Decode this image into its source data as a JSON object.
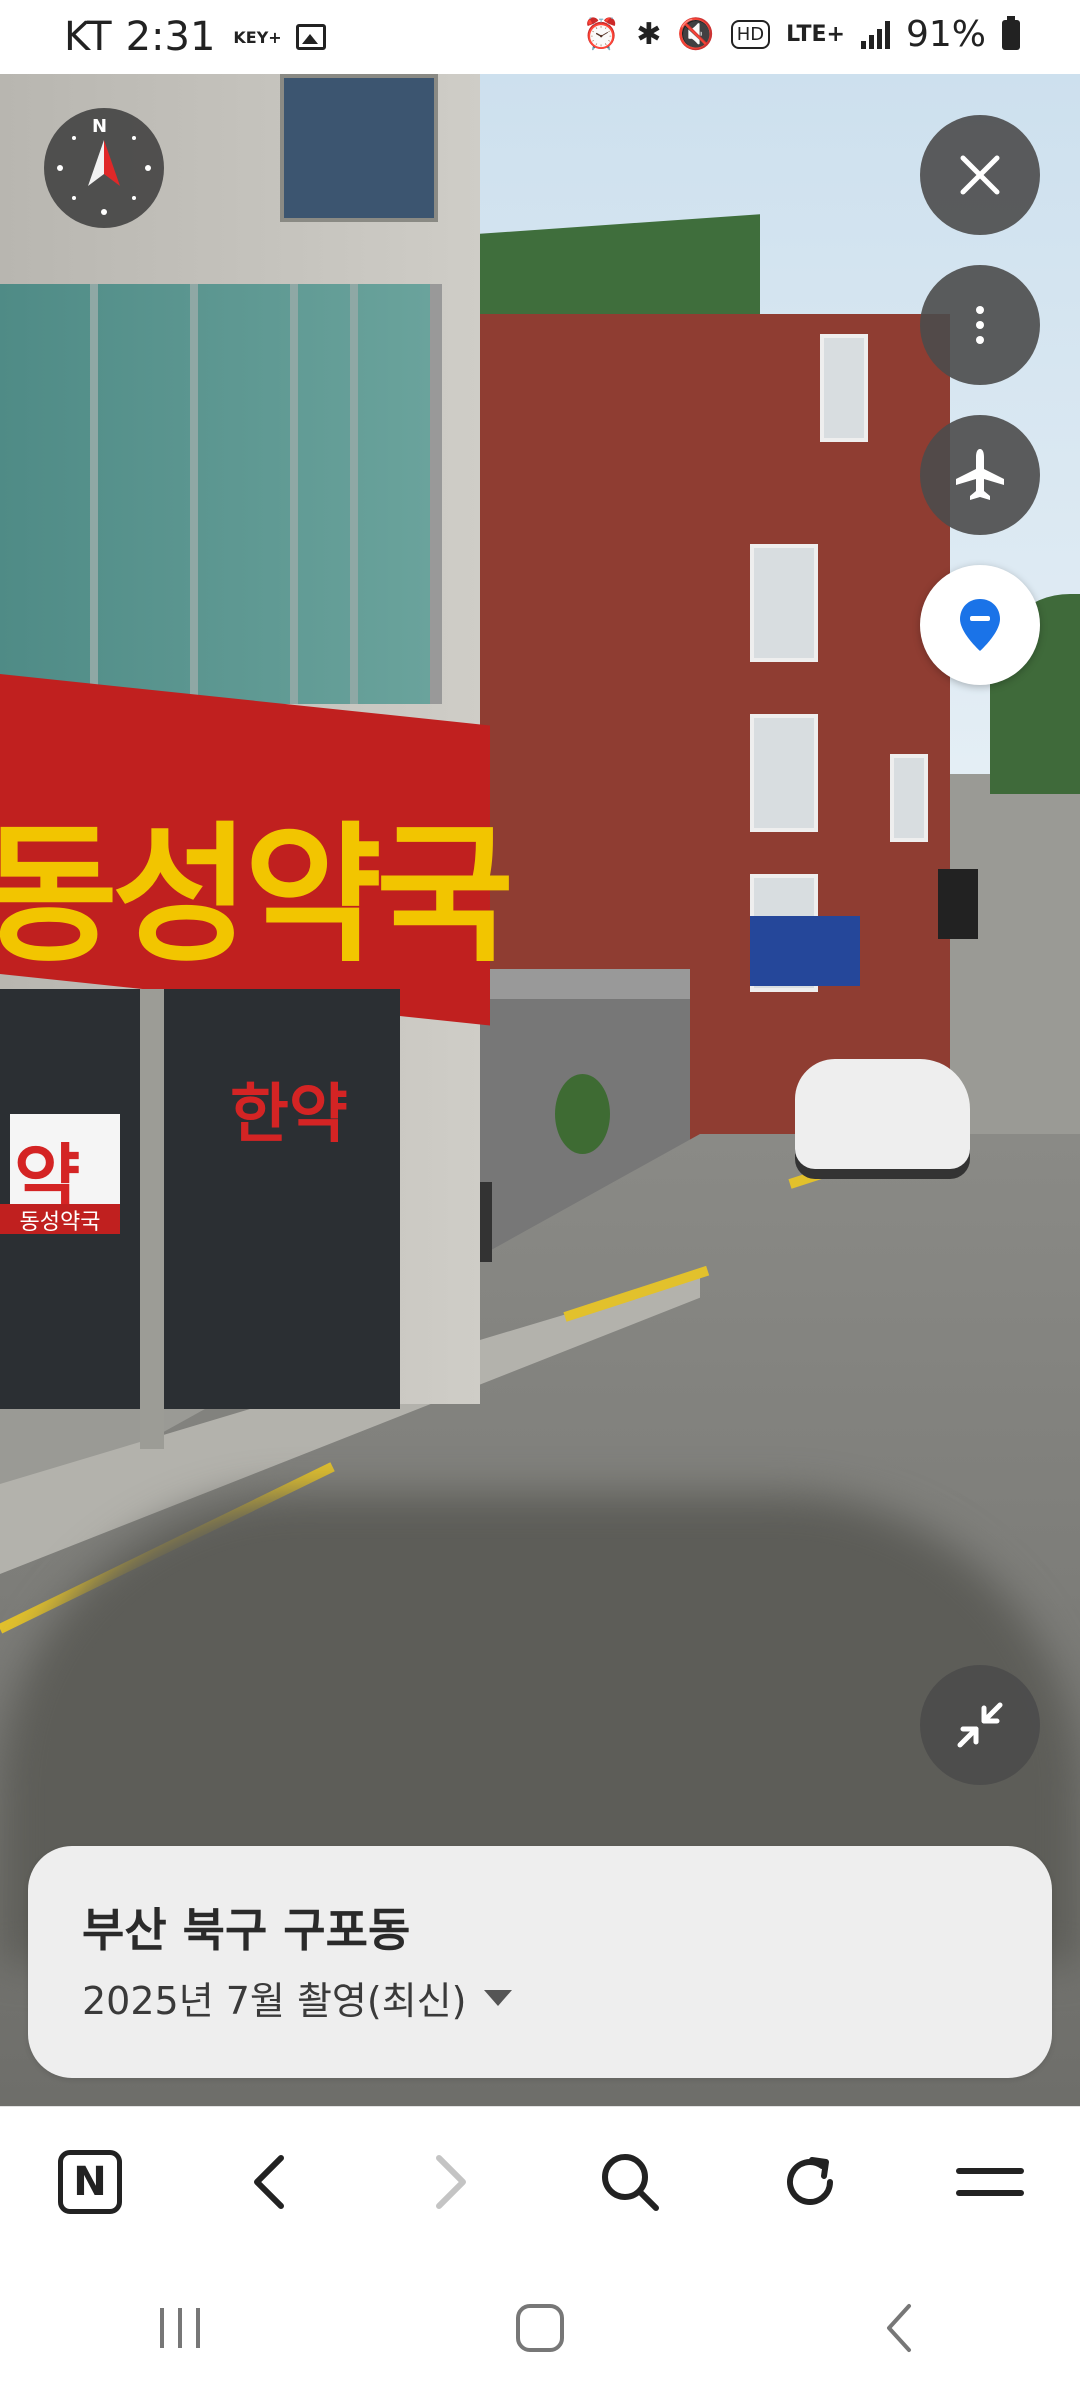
{
  "status_bar": {
    "carrier": "KT",
    "time": "2:31",
    "key_indicator": "KEY+",
    "network": "LTE+",
    "hd_label": "HD",
    "battery": "91%"
  },
  "street_view": {
    "signs": {
      "main_sign": "동성약국",
      "window_sticker": "약",
      "window_text": "한약",
      "window_label": "동성약국"
    },
    "controls": {
      "compass_label": "N",
      "icons": [
        "close-icon",
        "more-vert-icon",
        "airplane-icon",
        "location-pin-icon",
        "collapse-icon"
      ]
    }
  },
  "info_card": {
    "location": "부산 북구 구포동",
    "capture_date": "2025년 7월 촬영(최신)"
  },
  "browser_toolbar": {
    "n_label": "N",
    "icons": [
      "naver-n-icon",
      "back-icon",
      "forward-icon",
      "search-icon",
      "reload-icon",
      "menu-icon"
    ]
  },
  "navigation": {
    "icons": [
      "recent-apps-icon",
      "home-icon",
      "system-back-icon"
    ]
  },
  "colors": {
    "sign_red": "#c0201f",
    "sign_yellow": "#f2c500",
    "pin_blue": "#1a73e8",
    "fab_dark": "#4b4b4b"
  }
}
